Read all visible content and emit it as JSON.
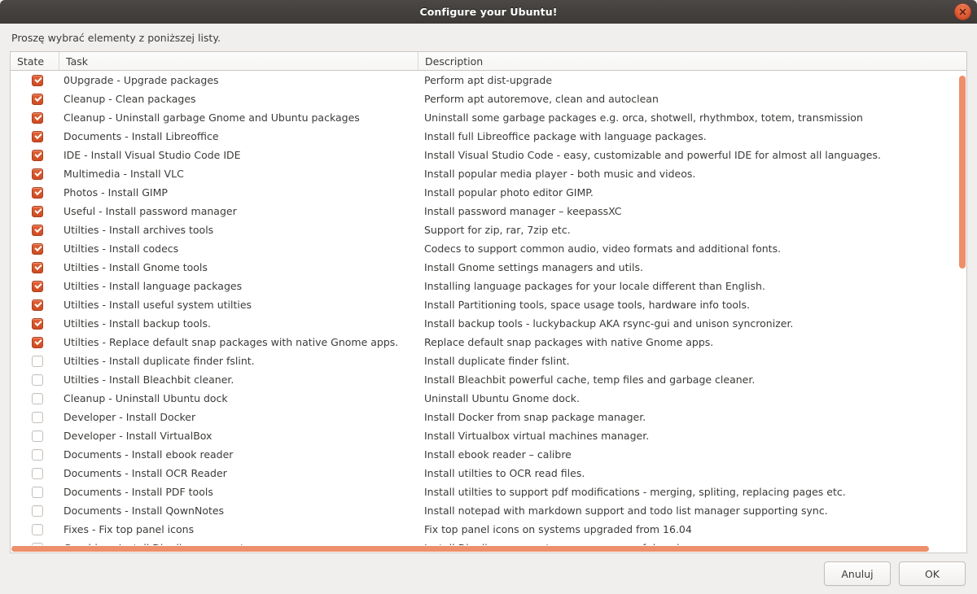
{
  "window": {
    "title": "Configure your Ubuntu!",
    "close_icon": "close-icon",
    "instruction": "Proszę wybrać elementy z poniższej listy."
  },
  "colors": {
    "titlebar_dark": "#3c3936",
    "accent_orange": "#cf4b23",
    "scrollbar_orange": "#ed8f6a",
    "window_bg": "#f0efee",
    "table_bg": "#ffffff",
    "text": "#3b3b39",
    "border": "#cdc7c2"
  },
  "table": {
    "columns": [
      "State",
      "Task",
      "Description"
    ],
    "rows": [
      {
        "checked": true,
        "task": "0Upgrade - Upgrade packages",
        "description": "Perform apt dist-upgrade"
      },
      {
        "checked": true,
        "task": "Cleanup - Clean packages",
        "description": "Perform apt autoremove, clean and autoclean"
      },
      {
        "checked": true,
        "task": "Cleanup - Uninstall garbage Gnome and Ubuntu packages",
        "description": "Uninstall some garbage packages e.g. orca, shotwell, rhythmbox, totem, transmission"
      },
      {
        "checked": true,
        "task": "Documents - Install Libreoffice",
        "description": "Install full Libreoffice package with language packages."
      },
      {
        "checked": true,
        "task": "IDE - Install Visual Studio Code IDE",
        "description": "Install Visual Studio Code - easy, customizable and powerful IDE for almost all languages."
      },
      {
        "checked": true,
        "task": "Multimedia - Install VLC",
        "description": "Install popular media player - both music and videos."
      },
      {
        "checked": true,
        "task": "Photos - Install GIMP",
        "description": "Install popular photo editor GIMP."
      },
      {
        "checked": true,
        "task": "Useful - Install password manager",
        "description": "Install password manager – keepassXC"
      },
      {
        "checked": true,
        "task": "Utilties - Install archives tools",
        "description": "Support for zip, rar, 7zip etc."
      },
      {
        "checked": true,
        "task": "Utilties - Install codecs",
        "description": "Codecs to support common audio, video formats and additional fonts."
      },
      {
        "checked": true,
        "task": "Utilties - Install Gnome tools",
        "description": "Install Gnome settings managers and utils."
      },
      {
        "checked": true,
        "task": "Utilties - Install language packages",
        "description": "Installing language packages for your locale different than English."
      },
      {
        "checked": true,
        "task": "Utilties - Install useful system utilties",
        "description": "Install Partitioning tools, space usage tools, hardware info tools."
      },
      {
        "checked": true,
        "task": "Utilties - Install backup tools.",
        "description": "Install backup tools - luckybackup AKA rsync-gui and unison syncronizer."
      },
      {
        "checked": true,
        "task": "Utilties - Replace default snap packages with native Gnome apps.",
        "description": "Replace default snap packages with native Gnome apps."
      },
      {
        "checked": false,
        "task": "Utilties - Install duplicate finder fslint.",
        "description": "Install duplicate finder fslint."
      },
      {
        "checked": false,
        "task": "Utilties - Install Bleachbit cleaner.",
        "description": "Install Bleachbit powerful cache, temp files and garbage cleaner."
      },
      {
        "checked": false,
        "task": "Cleanup - Uninstall Ubuntu dock",
        "description": "Uninstall Ubuntu Gnome dock."
      },
      {
        "checked": false,
        "task": "Developer - Install Docker",
        "description": "Install Docker from snap package manager."
      },
      {
        "checked": false,
        "task": "Developer - Install VirtualBox",
        "description": "Install Virtualbox virtual machines manager."
      },
      {
        "checked": false,
        "task": "Documents - Install ebook reader",
        "description": "Install ebook reader – calibre"
      },
      {
        "checked": false,
        "task": "Documents - Install OCR Reader",
        "description": "Install utilties to OCR read files."
      },
      {
        "checked": false,
        "task": "Documents - Install PDF tools",
        "description": "Install utilties to support pdf modifications  - merging, spliting, replacing pages etc."
      },
      {
        "checked": false,
        "task": "Documents - Install QownNotes",
        "description": "Install notepad with markdown support and todo list manager supporting sync."
      },
      {
        "checked": false,
        "task": "Fixes - Fix top panel icons",
        "description": "Fix top panel icons on systems upgraded from 16.04"
      },
      {
        "checked": false,
        "task": "Graphics - Install Dia diagram creator",
        "description": "Install Dia diagram creator - open source of draw.io"
      }
    ],
    "vertical_scroll": {
      "thumb_top_pct": 1,
      "thumb_height_pct": 40
    },
    "horizontal_scroll": {
      "thumb_width_pct": 96
    }
  },
  "actions": {
    "cancel_label": "Anuluj",
    "ok_label": "OK"
  }
}
